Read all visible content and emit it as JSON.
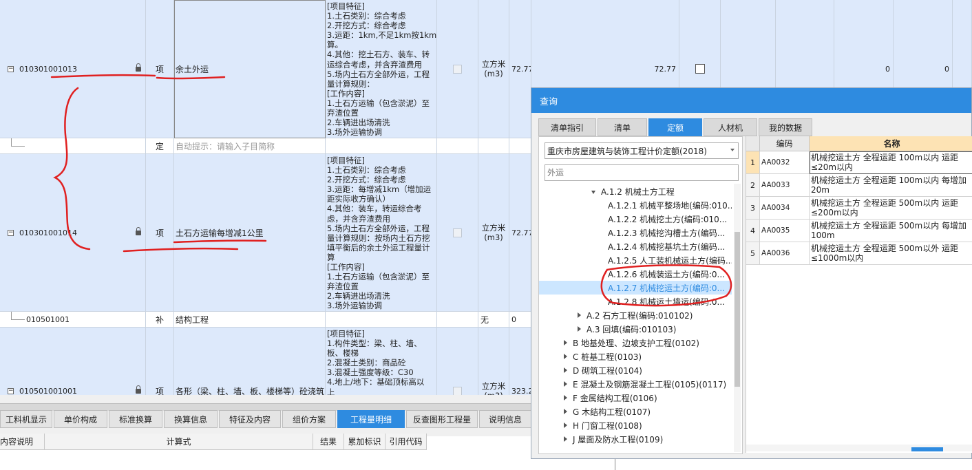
{
  "grid": {
    "rows": [
      {
        "code": "010301001013",
        "type": "项",
        "name": "余土外运",
        "features": "[项目特征]\n1.土石类别：综合考虑\n2.开挖方式：综合考虑\n3.运距：1km,不足1km按1km计\n算。\n4.其他：挖土石方、装车、转\n运综合考虑，并含弃渣费用\n5.场内土石方全部外运，工程\n量计算规则：\n[工作内容]\n1.土石方运输（包含淤泥）至\n弃渣位置\n2.车辆进出场清洗\n3.场外运输协调",
        "unit": "立方米\n(m3)",
        "qty": "72.77",
        "qty2": "72.77",
        "v1": "0",
        "v2": "0"
      },
      {
        "type": "定",
        "hint": "自动提示：请输入子目简称"
      },
      {
        "code": "010301001014",
        "type": "项",
        "name": "土石方运输每增减1公里",
        "features": "[项目特征]\n1.土石类别：综合考虑\n2.开挖方式：综合考虑\n3.运距：每增减1km（增加运\n距实际收方确认）\n4.其他：装车，转运综合考\n虑，并含弃渣费用\n5.场内土石方全部外运，工程\n量计算规则：按场内土石方挖\n填平衡后的余土外运工程量计\n算\n[工作内容]\n1.土石方运输（包含淤泥）至\n弃渣位置\n2.车辆进出场清洗\n3.场外运输协调",
        "unit": "立方米\n(m3)",
        "qty": "72.77"
      },
      {
        "code": "010501001",
        "type": "补",
        "name": "结构工程",
        "unit": "无",
        "qty": "0"
      },
      {
        "code": "010501001001",
        "type": "项",
        "name": "各形（梁、柱、墙、板、楼梯等）砼浇筑",
        "features": "[项目特征]\n1.构件类型：梁、柱、墙、\n板、楼梯\n2.混凝土类别：商品砼\n3.混凝土强度等级：C30\n4.地上/地下：基础顶标高以\n上",
        "unit": "立方米\n(m3)",
        "qty": "323.2"
      }
    ]
  },
  "bottom_tabs": [
    "工料机显示",
    "单价构成",
    "标准换算",
    "换算信息",
    "特征及内容",
    "组价方案",
    "工程量明细",
    "反查图形工程量",
    "说明信息"
  ],
  "bottom_active": "工程量明细",
  "detail_headers": [
    "内容说明",
    "计算式",
    "结果",
    "累加标识",
    "引用代码"
  ],
  "dialog": {
    "title": "查询",
    "tabs": [
      "清单指引",
      "清单",
      "定额",
      "人材机",
      "我的数据"
    ],
    "active_tab": "定额",
    "quota_select": "重庆市房屋建筑与装饰工程计价定额(2018)",
    "search_placeholder": "外运",
    "tree": [
      {
        "label": "A.1.2 机械土方工程",
        "level": 2,
        "exp": "open"
      },
      {
        "label": "A.1.2.1 机械平整场地(编码:010...",
        "level": 3
      },
      {
        "label": "A.1.2.2 机械挖土方(编码:010...",
        "level": 3
      },
      {
        "label": "A.1.2.3 机械挖沟槽土方(编码...",
        "level": 3
      },
      {
        "label": "A.1.2.4 机械挖基坑土方(编码...",
        "level": 3
      },
      {
        "label": "A.1.2.5 人工装机械运土方(编码...",
        "level": 3
      },
      {
        "label": "A.1.2.6 机械装运土方(编码:0...",
        "level": 3
      },
      {
        "label": "A.1.2.7 机械挖运土方(编码:0...",
        "level": 3,
        "sel": true
      },
      {
        "label": "A.1.2.8 机械运土墙运(编码:0...",
        "level": 3
      },
      {
        "label": "A.2 石方工程(编码:010102)",
        "level": 1,
        "exp": "closed"
      },
      {
        "label": "A.3 回填(编码:010103)",
        "level": 1,
        "exp": "closed"
      },
      {
        "label": "B 地基处理、边坡支护工程(0102)",
        "level": 0,
        "exp": "closed"
      },
      {
        "label": "C 桩基工程(0103)",
        "level": 0,
        "exp": "closed"
      },
      {
        "label": "D 砌筑工程(0104)",
        "level": 0,
        "exp": "closed"
      },
      {
        "label": "E 混凝土及钢筋混凝土工程(0105)(0117)",
        "level": 0,
        "exp": "closed"
      },
      {
        "label": "F 金属结构工程(0106)",
        "level": 0,
        "exp": "closed"
      },
      {
        "label": "G 木结构工程(0107)",
        "level": 0,
        "exp": "closed"
      },
      {
        "label": "H 门窗工程(0108)",
        "level": 0,
        "exp": "closed"
      },
      {
        "label": "J 屋面及防水工程(0109)",
        "level": 0,
        "exp": "closed"
      }
    ],
    "result_headers": [
      "编码",
      "名称"
    ],
    "results": [
      {
        "idx": "1",
        "code": "AA0032",
        "name": "机械挖运土方 全程运距 100m以内 运距≤20m以内"
      },
      {
        "idx": "2",
        "code": "AA0033",
        "name": "机械挖运土方 全程运距 100m以内 每增加20m"
      },
      {
        "idx": "3",
        "code": "AA0034",
        "name": "机械挖运土方 全程运距 500m以内 运距≤200m以内"
      },
      {
        "idx": "4",
        "code": "AA0035",
        "name": "机械挖运土方 全程运距 500m以内 每增加100m"
      },
      {
        "idx": "5",
        "code": "AA0036",
        "name": "机械挖运土方 全程运距 500m以外 运距≤1000m以内"
      }
    ]
  },
  "colors": {
    "accent": "#2e8be0",
    "row_bg": "#dde9fb",
    "annotation": "#e02020"
  }
}
